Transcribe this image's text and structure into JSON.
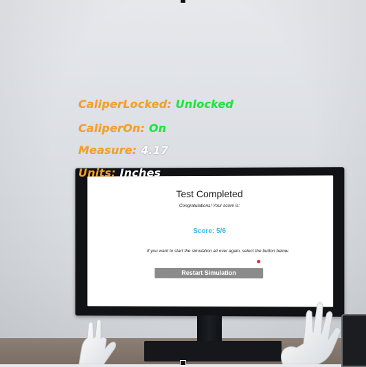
{
  "hud": [
    {
      "key": "CaliperLocked:",
      "value": "Unlocked",
      "value_color": "green"
    },
    {
      "key": "CaliperOn:",
      "value": "On",
      "value_color": "green"
    },
    {
      "key": "Measure:",
      "value": "4.17",
      "value_color": "white"
    },
    {
      "key": "Units:",
      "value": "Inches",
      "value_color": "white"
    }
  ],
  "screen": {
    "title": "Test Completed",
    "subtitle": "Congratulations! Your score is:",
    "score": "Score: 5/6",
    "instruction": "If you want to start the simulation all over again, select the button below.",
    "restart_label": "Restart Simulation"
  },
  "colors": {
    "hud_key": "#f5a023",
    "hud_green": "#19e83a",
    "score_blue": "#3ab6e8",
    "button_gray": "#8b8b8b"
  }
}
